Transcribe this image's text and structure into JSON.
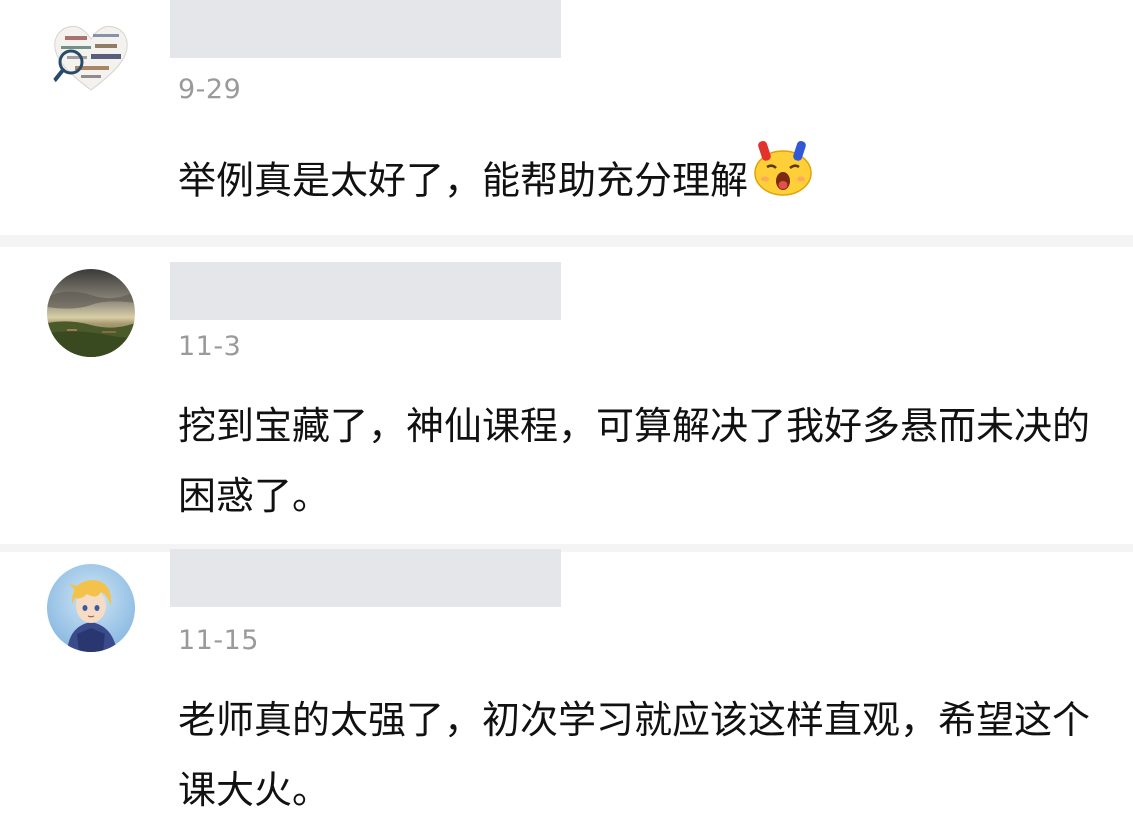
{
  "comments": [
    {
      "date": "9-29",
      "text": "举例真是太好了，能帮助充分理解",
      "emoji": "amazed-face-emoji",
      "avatar": "word-cloud-heart-avatar"
    },
    {
      "date": "11-3",
      "text": "挖到宝藏了，神仙课程，可算解决了我好多悬而未决的困惑了。",
      "avatar": "landscape-sky-avatar"
    },
    {
      "date": "11-15",
      "text": "老师真的太强了，初次学习就应该这样直观，希望这个课大火。",
      "avatar": "anime-character-avatar"
    }
  ],
  "colors": {
    "background": "#ffffff",
    "separator": "#f4f4f4",
    "redacted_name": "#e4e6ea",
    "date_text": "#9a9a9a",
    "body_text": "#111111"
  }
}
